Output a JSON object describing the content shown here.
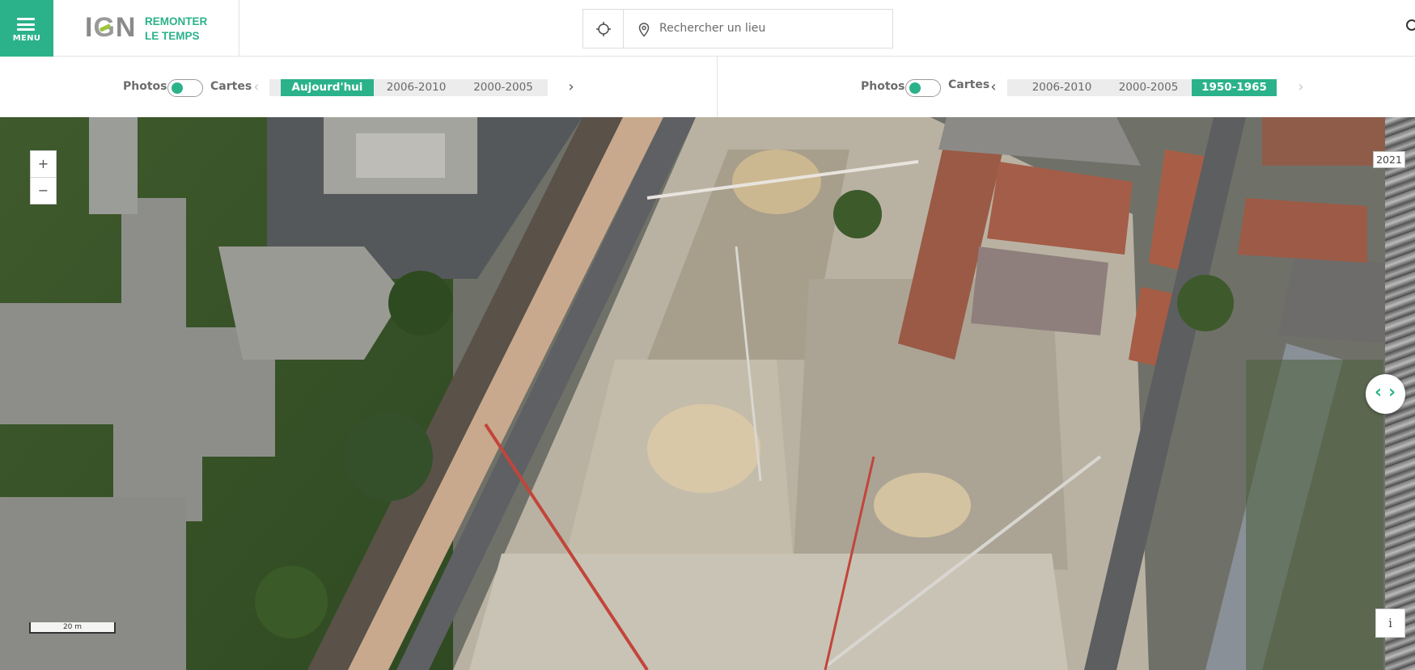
{
  "header": {
    "menu_label": "MENU",
    "logo_text": "IGN",
    "app_title_line1": "REMONTER",
    "app_title_line2": "LE TEMPS",
    "search_placeholder": "Rechercher un lieu",
    "brand_color": "#2bb28a"
  },
  "left_panel": {
    "toggle_left_label": "Photos",
    "toggle_right_label": "Cartes",
    "mode": "Photos",
    "periods": [
      "Aujourd'hui",
      "2006-2010",
      "2000-2005"
    ],
    "active_period": "Aujourd'hui"
  },
  "right_panel": {
    "toggle_left_label": "Photos",
    "toggle_right_label": "Cartes",
    "mode": "Photos",
    "periods": [
      "2006-2010",
      "2000-2005",
      "1950-1965"
    ],
    "active_period": "1950-1965"
  },
  "map": {
    "zoom_in_label": "+",
    "zoom_out_label": "−",
    "year_badge": "2021",
    "info_label": "i",
    "scale_label": "20 m",
    "swipe_handle_label_left": "‹",
    "swipe_handle_label_right": "›"
  }
}
